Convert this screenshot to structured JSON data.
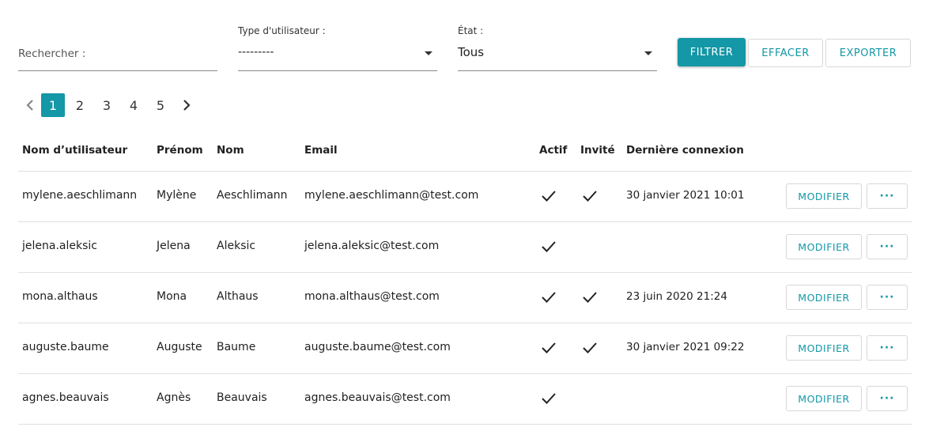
{
  "filters": {
    "search": {
      "label": "Rechercher :",
      "value": ""
    },
    "user_type": {
      "label": "Type d'utilisateur :",
      "value": "---------"
    },
    "state": {
      "label": "État :",
      "value": "Tous"
    }
  },
  "actions": {
    "filter": "FILTRER",
    "clear": "EFFACER",
    "export": "EXPORTER"
  },
  "pagination": {
    "pages": [
      "1",
      "2",
      "3",
      "4",
      "5"
    ],
    "current": "1"
  },
  "table": {
    "headers": {
      "username": "Nom d’utilisateur",
      "firstname": "Prénom",
      "lastname": "Nom",
      "email": "Email",
      "active": "Actif",
      "invited": "Invité",
      "last_login": "Dernière connexion"
    },
    "rows": [
      {
        "username": "mylene.aeschlimann",
        "firstname": "Mylène",
        "lastname": "Aeschlimann",
        "email": "mylene.aeschlimann@test.com",
        "active": true,
        "invited": true,
        "last_login": "30 janvier 2021 10:01"
      },
      {
        "username": "jelena.aleksic",
        "firstname": "Jelena",
        "lastname": "Aleksic",
        "email": "jelena.aleksic@test.com",
        "active": true,
        "invited": false,
        "last_login": ""
      },
      {
        "username": "mona.althaus",
        "firstname": "Mona",
        "lastname": "Althaus",
        "email": "mona.althaus@test.com",
        "active": true,
        "invited": true,
        "last_login": "23 juin 2020 21:24"
      },
      {
        "username": "auguste.baume",
        "firstname": "Auguste",
        "lastname": "Baume",
        "email": "auguste.baume@test.com",
        "active": true,
        "invited": true,
        "last_login": "30 janvier 2021 09:22"
      },
      {
        "username": "agnes.beauvais",
        "firstname": "Agnès",
        "lastname": "Beauvais",
        "email": "agnes.beauvais@test.com",
        "active": true,
        "invited": false,
        "last_login": ""
      }
    ],
    "row_actions": {
      "edit": "MODIFIER",
      "more": "···"
    }
  },
  "colors": {
    "accent": "#1497a6",
    "text": "#212121",
    "divider": "#e0e0e0"
  },
  "icons": {
    "prev": "chevron-left-icon",
    "next": "chevron-right-icon",
    "dropdown": "caret-down-icon",
    "check": "check-icon"
  }
}
